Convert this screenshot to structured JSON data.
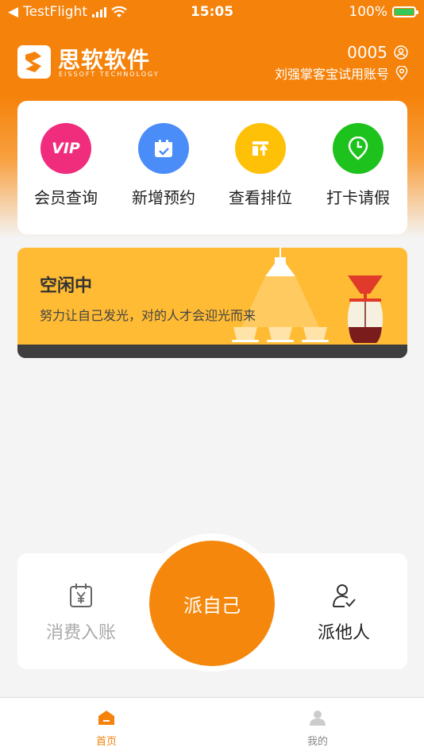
{
  "status_bar": {
    "carrier": "TestFlight",
    "time": "15:05",
    "battery": "100%"
  },
  "header": {
    "brand_cn": "思软软件",
    "brand_en": "EISSOFT TECHNOLOGY",
    "store_code": "0005",
    "store_name": "刘强掌客宝试用账号"
  },
  "quick_menu": {
    "items": [
      {
        "label": "会员查询",
        "icon": "vip-icon",
        "color": "#f02d7d"
      },
      {
        "label": "新增预约",
        "icon": "calendar-check-icon",
        "color": "#4b8df8"
      },
      {
        "label": "查看排位",
        "icon": "ranking-icon",
        "color": "#ffc107"
      },
      {
        "label": "打卡请假",
        "icon": "clock-pin-icon",
        "color": "#1dc21d"
      }
    ]
  },
  "banner": {
    "title": "空闲中",
    "subtitle": "努力让自己发光，对的人才会迎光而来"
  },
  "actions": {
    "left_label": "消费入账",
    "center_label": "派自己",
    "right_label": "派他人"
  },
  "tabbar": {
    "items": [
      {
        "label": "首页",
        "active": true
      },
      {
        "label": "我的",
        "active": false
      }
    ],
    "active_color": "#f5820a",
    "inactive_color": "#888888"
  },
  "colors": {
    "brand_orange": "#f5820a",
    "banner_yellow": "#ffbb33"
  }
}
